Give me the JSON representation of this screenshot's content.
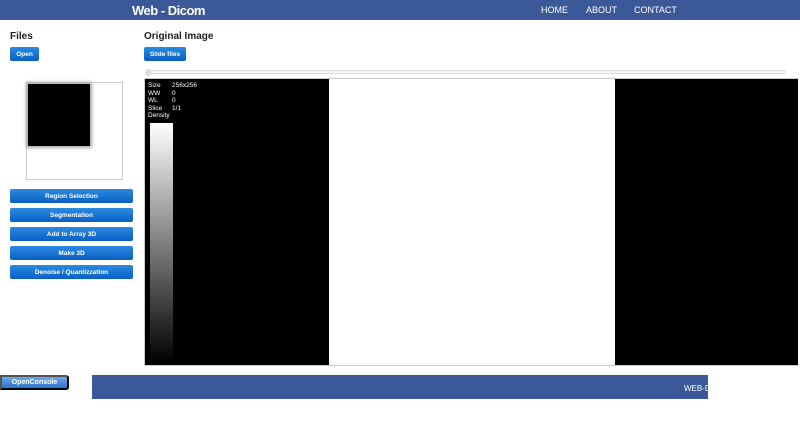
{
  "header": {
    "brand": "Web - Dicom",
    "nav": [
      "HOME",
      "ABOUT",
      "CONTACT"
    ]
  },
  "files": {
    "title": "Files",
    "open_label": "Open"
  },
  "tools": [
    "Region Selection",
    "Segmentation",
    "Add to Array 3D",
    "Make 3D",
    "Denoise / Quantizzation"
  ],
  "main": {
    "title": "Original Image",
    "slide_label": "Slide files",
    "slider_value": 0
  },
  "overlay": {
    "size_label": "Size",
    "size": "256x256",
    "ww_label": "WW",
    "ww": "0",
    "wl_label": "WL",
    "wl": "0",
    "slice_label": "Slice",
    "slice": "1/1",
    "density_label": "Density"
  },
  "console_label": "OpenConsole",
  "footer": {
    "text": "WEB-DICOM"
  },
  "colors": {
    "header": "#3b5998",
    "button": "#0a6fd6"
  }
}
